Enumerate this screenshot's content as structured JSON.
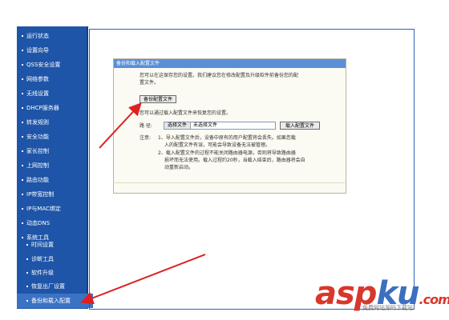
{
  "sidebar": {
    "items": [
      {
        "label": "运行状态"
      },
      {
        "label": "设置向导"
      },
      {
        "label": "QSS安全设置"
      },
      {
        "label": "网络参数"
      },
      {
        "label": "无线设置"
      },
      {
        "label": "DHCP服务器"
      },
      {
        "label": "转发规则"
      },
      {
        "label": "安全功能"
      },
      {
        "label": "家长控制"
      },
      {
        "label": "上网控制"
      },
      {
        "label": "路由功能"
      },
      {
        "label": "IP带宽控制"
      },
      {
        "label": "IP与MAC绑定"
      },
      {
        "label": "动态DNS"
      },
      {
        "label": "系统工具"
      },
      {
        "label": "时间设置"
      },
      {
        "label": "诊断工具"
      },
      {
        "label": "软件升级"
      },
      {
        "label": "恢复出厂设置"
      },
      {
        "label": "备份和载入配置"
      }
    ]
  },
  "panel": {
    "title": "备份和载入配置文件",
    "intro_line1": "您可以在这保存您的设置。我们建议您在修改配置及升级软件前备份您的配",
    "intro_line2": "置文件。",
    "backup_button": "备份配置文件",
    "load_intro": "您可以通过载入配置文件来恢复您的设置。",
    "path_label": "路 径:",
    "choose_file_button": "选择文件",
    "no_file_text": "未选择文件",
    "load_button": "载入配置文件",
    "note_label": "注意:",
    "note1_line1": "1、导入配置文件后，设备中原有的用户配置将会丢失。如果您载",
    "note1_line2": "入的配置文件有误，可能会导致设备无法被管理。",
    "note2_line1": "2、载入配置文件的过程不能关闭路由器电源，否则将导致路由器",
    "note2_line2": "损坏而无法使用。载入过程约20秒，当载入结束后，路由器将会自",
    "note2_line3": "动重新启动。"
  },
  "watermark": {
    "part1": "asp",
    "part2": "ku",
    "part3": ".com",
    "subtitle": "免费网站源码下载站!",
    "color_asp": "#d9362c",
    "color_ku": "#3b6fc0"
  },
  "colors": {
    "sidebar_bg": "#1e55a8",
    "panel_header": "#5a8fd6",
    "arrow": "#e02020"
  }
}
